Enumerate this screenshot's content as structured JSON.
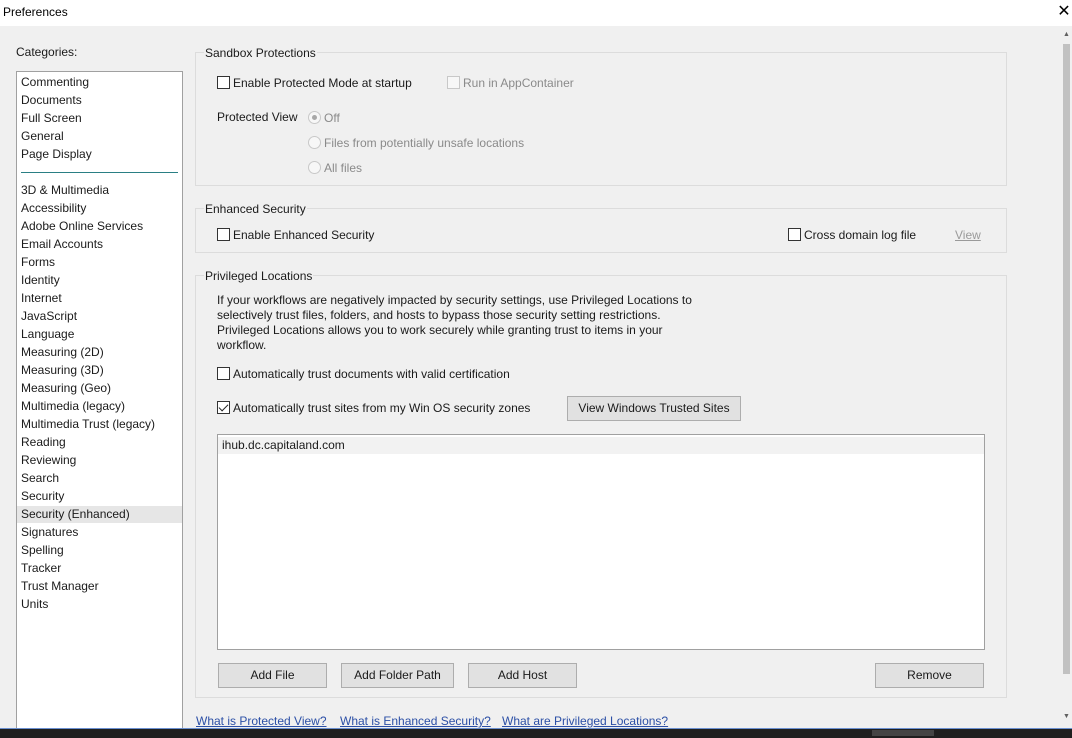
{
  "window": {
    "title": "Preferences",
    "close_glyph": "✕"
  },
  "categories": {
    "label": "Categories:",
    "top_items": [
      "Commenting",
      "Documents",
      "Full Screen",
      "General",
      "Page Display"
    ],
    "items": [
      "3D & Multimedia",
      "Accessibility",
      "Adobe Online Services",
      "Email Accounts",
      "Forms",
      "Identity",
      "Internet",
      "JavaScript",
      "Language",
      "Measuring (2D)",
      "Measuring (3D)",
      "Measuring (Geo)",
      "Multimedia (legacy)",
      "Multimedia Trust (legacy)",
      "Reading",
      "Reviewing",
      "Search",
      "Security",
      "Security (Enhanced)",
      "Signatures",
      "Spelling",
      "Tracker",
      "Trust Manager",
      "Units"
    ],
    "selected": "Security (Enhanced)"
  },
  "sandbox": {
    "title": "Sandbox Protections",
    "protected_mode_label": "Enable Protected Mode at startup",
    "protected_mode_checked": false,
    "run_appcontainer_label": "Run in AppContainer",
    "run_appcontainer_checked": false,
    "protected_view_label": "Protected View",
    "pv_options": [
      "Off",
      "Files from potentially unsafe locations",
      "All files"
    ],
    "pv_selected": "Off"
  },
  "enhanced": {
    "title": "Enhanced Security",
    "enable_label": "Enable Enhanced Security",
    "enable_checked": false,
    "cross_domain_label": "Cross domain log file",
    "cross_domain_checked": false,
    "view_link": "View"
  },
  "privileged": {
    "title": "Privileged Locations",
    "description": [
      "If your workflows are negatively impacted by security settings, use Privileged Locations to",
      "selectively trust files, folders, and hosts to bypass those security setting restrictions.",
      "Privileged Locations allows you to work securely while granting trust to items in your",
      "workflow."
    ],
    "auto_cert_label": "Automatically trust documents with valid certification",
    "auto_cert_checked": false,
    "auto_sites_label": "Automatically trust sites from my Win OS security zones",
    "auto_sites_checked": true,
    "view_trusted_sites_button": "View Windows Trusted Sites",
    "locations": [
      "ihub.dc.capitaland.com"
    ],
    "buttons": {
      "add_file": "Add File",
      "add_folder": "Add Folder Path",
      "add_host": "Add Host",
      "remove": "Remove"
    }
  },
  "help_links": [
    "What is Protected View?",
    "What is Enhanced Security?",
    "What are Privileged Locations?"
  ],
  "colors": {
    "accent_divider": "#2a7f84",
    "link": "#2b4fa6",
    "selection": "#e6e6e6"
  }
}
